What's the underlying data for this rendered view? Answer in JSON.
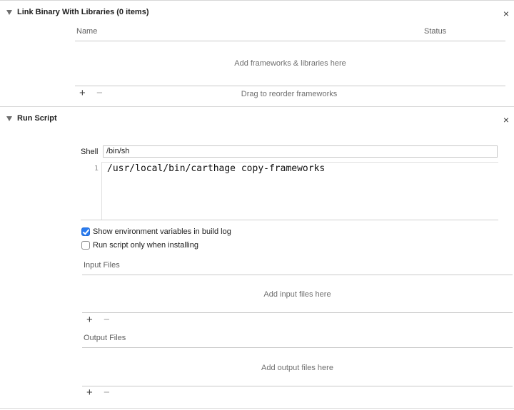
{
  "link_section": {
    "title": "Link Binary With Libraries (0 items)",
    "columns": {
      "name": "Name",
      "status": "Status"
    },
    "placeholder": "Add frameworks & libraries here",
    "add": "+",
    "remove": "−",
    "hint": "Drag to reorder frameworks"
  },
  "run_script": {
    "title": "Run Script",
    "shell_label": "Shell",
    "shell_value": "/bin/sh",
    "line_number": "1",
    "code": "/usr/local/bin/carthage copy-frameworks",
    "options": [
      {
        "label": "Show environment variables in build log",
        "checked": true
      },
      {
        "label": "Run script only when installing",
        "checked": false
      }
    ],
    "input_files": {
      "header": "Input Files",
      "placeholder": "Add input files here",
      "add": "+",
      "remove": "−"
    },
    "output_files": {
      "header": "Output Files",
      "placeholder": "Add output files here",
      "add": "+",
      "remove": "−"
    }
  },
  "close_glyph": "×"
}
